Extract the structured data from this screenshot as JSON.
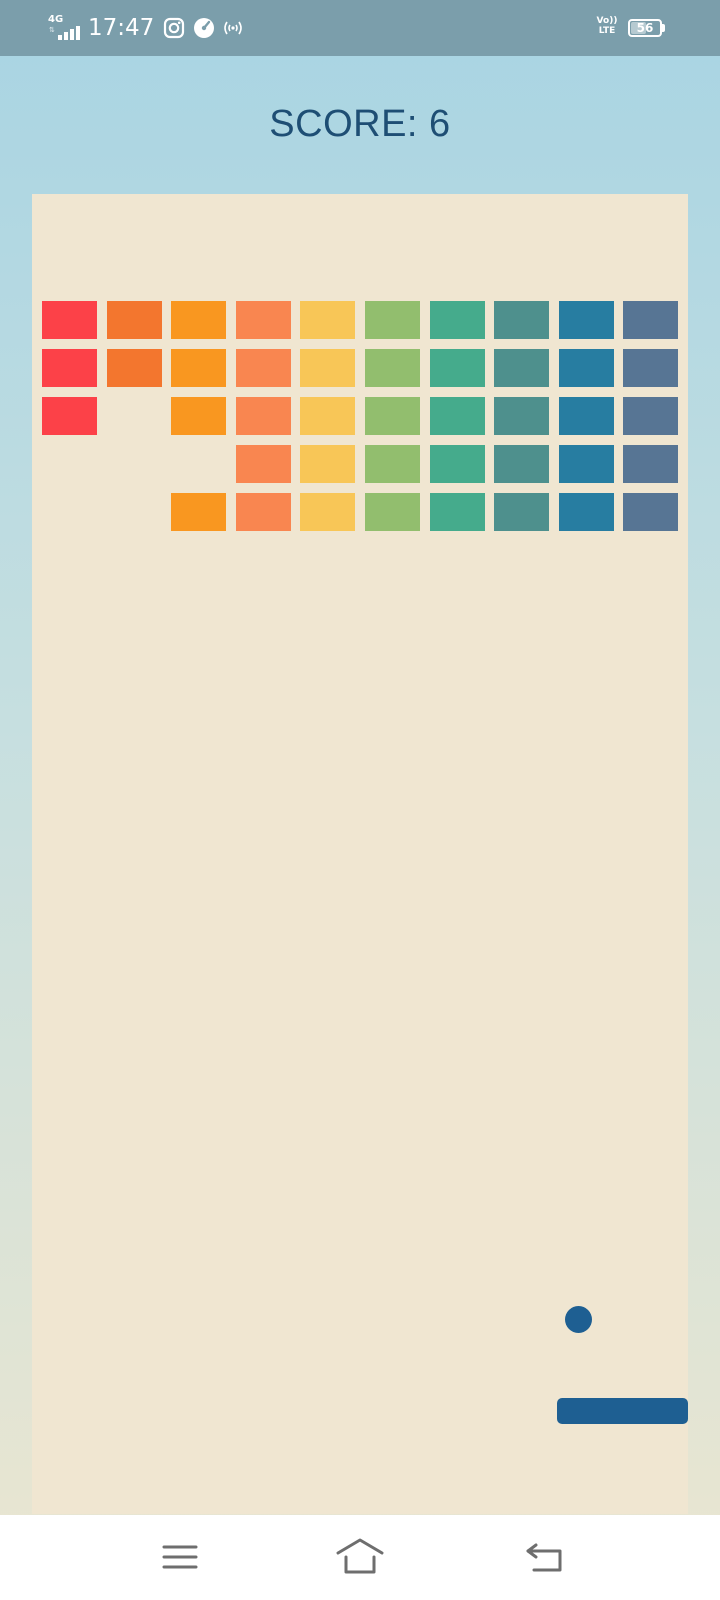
{
  "status_bar": {
    "network": "4G",
    "network_arrows": "⇅",
    "signal_bars": 4,
    "time": "17:47",
    "volte_line1": "Vo))",
    "volte_line2": "LTE",
    "battery": "56",
    "battery_level": 0.56,
    "icons": [
      "instagram-icon",
      "speedometer-icon",
      "hotspot-icon"
    ]
  },
  "header": {
    "score_label": "SCORE: 6"
  },
  "game": {
    "columns": 10,
    "rows": 5,
    "brick_colors": [
      "#fc4148",
      "#f3762e",
      "#f99720",
      "#f98650",
      "#f8c657",
      "#92be6e",
      "#45ab8c",
      "#4e908d",
      "#277da1",
      "#577594"
    ],
    "bricks_present": [
      [
        1,
        1,
        1,
        1,
        1,
        1,
        1,
        1,
        1,
        1
      ],
      [
        1,
        1,
        1,
        1,
        1,
        1,
        1,
        1,
        1,
        1
      ],
      [
        1,
        0,
        1,
        1,
        1,
        1,
        1,
        1,
        1,
        1
      ],
      [
        0,
        0,
        0,
        1,
        1,
        1,
        1,
        1,
        1,
        1
      ],
      [
        0,
        0,
        1,
        1,
        1,
        1,
        1,
        1,
        1,
        1
      ]
    ],
    "ball_color": "#1e5f92",
    "paddle_color": "#1e5f92"
  },
  "nav_bar": {
    "buttons": [
      "menu-icon",
      "home-icon",
      "back-icon"
    ]
  }
}
